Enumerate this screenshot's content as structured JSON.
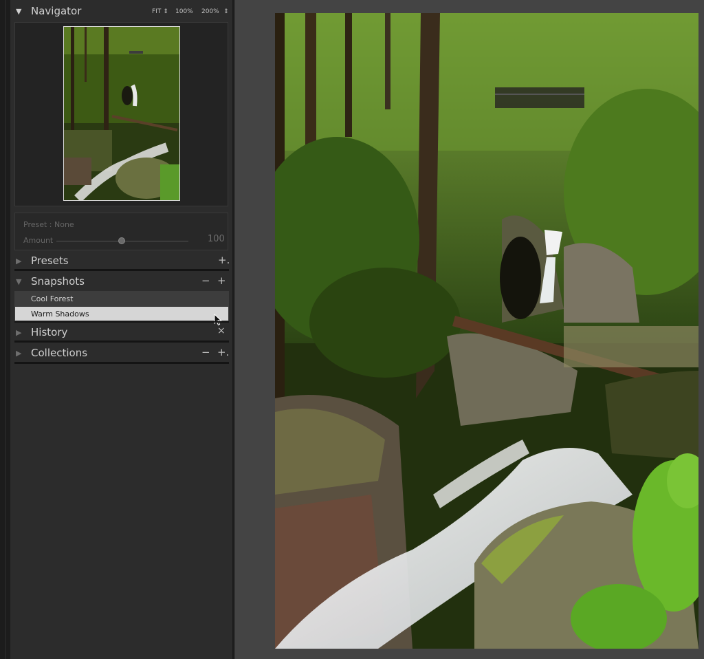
{
  "navigator": {
    "title": "Navigator",
    "zoom": {
      "fit": "FIT",
      "z100": "100%",
      "z200": "200%"
    }
  },
  "preset": {
    "label": "Preset : None",
    "amount_label": "Amount",
    "amount_value": "100",
    "amount_level_percent": 100
  },
  "panels": {
    "presets": "Presets",
    "snapshots": "Snapshots",
    "history": "History",
    "collections": "Collections"
  },
  "snapshots": {
    "items": [
      {
        "label": "Cool Forest",
        "selected": false
      },
      {
        "label": "Warm Shadows",
        "selected": true
      }
    ]
  },
  "icons": {
    "minus": "−",
    "plus": "+",
    "plus_dropdown": "+.",
    "close": "×",
    "triangle_down": "▼",
    "triangle_right": "▶"
  },
  "colors": {
    "panel_bg": "#2c2c2c",
    "canvas_bg": "#444444",
    "selected_row": "#d6d6d6"
  }
}
